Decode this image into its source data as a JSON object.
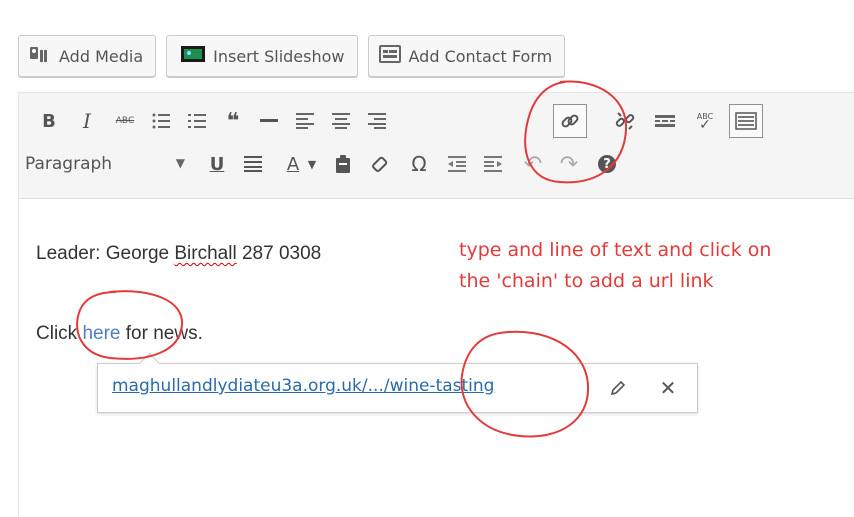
{
  "media_buttons": {
    "add_media": "Add Media",
    "insert_slideshow": "Insert Slideshow",
    "add_contact_form": "Add Contact Form"
  },
  "toolbar": {
    "bold": "B",
    "italic": "I",
    "strikethrough": "ABC",
    "blockquote": "66",
    "spellcheck": "ABC",
    "format_select": "Paragraph",
    "underline": "U",
    "text_color": "A",
    "special_char": "Ω",
    "help": "?"
  },
  "content": {
    "line1_prefix": "Leader: George ",
    "line1_spelled": "Birchall",
    "line1_suffix": " 287 0308",
    "line2_prefix": "Click ",
    "line2_link": "here",
    "line2_suffix": " for news."
  },
  "link_popup": {
    "url": "maghullandlydiateu3a.org.uk/.../wine-tasting"
  },
  "annotation": {
    "line1": "type and line of text and click on",
    "line2": "the 'chain' to add a url link"
  },
  "colors": {
    "annotation": "#e33b3b",
    "link": "#2a6ba8",
    "toolbar_bg": "#f5f5f5"
  }
}
